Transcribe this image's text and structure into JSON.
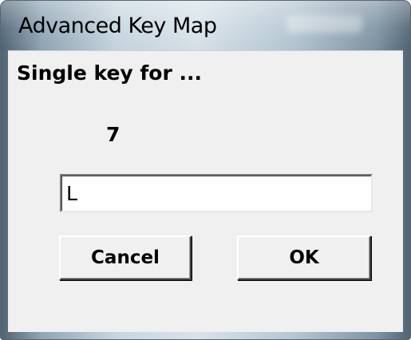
{
  "window": {
    "title": "Advanced Key Map"
  },
  "dialog": {
    "heading": "Single key for ...",
    "key": "7",
    "input_value": "L"
  },
  "buttons": {
    "cancel_label": "Cancel",
    "ok_label": "OK"
  }
}
